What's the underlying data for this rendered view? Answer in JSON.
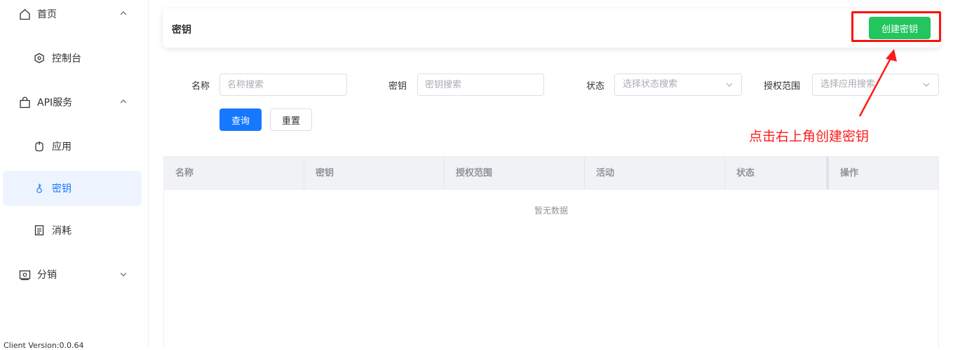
{
  "sidebar": {
    "groups": [
      {
        "label": "首页"
      },
      {
        "label": "API服务"
      },
      {
        "label": "分销"
      }
    ],
    "items": [
      {
        "label": "控制台"
      },
      {
        "label": "应用"
      },
      {
        "label": "密钥"
      },
      {
        "label": "消耗"
      }
    ],
    "version": "Client Version:0.0.64",
    "accent_color": "#eef4ff"
  },
  "header": {
    "title": "密钥",
    "create_button": "创建密钥",
    "create_button_color": "#22c55e"
  },
  "filters": {
    "name_label": "名称",
    "name_placeholder": "名称搜索",
    "key_label": "密钥",
    "key_placeholder": "密钥搜索",
    "status_label": "状态",
    "status_placeholder": "选择状态搜索",
    "scope_label": "授权范围",
    "scope_placeholder": "选择应用搜索",
    "query_button": "查询",
    "reset_button": "重置",
    "primary_color": "#1677ff"
  },
  "annotation": {
    "text": "点击右上角创建密钥",
    "color": "#ff1a1a"
  },
  "table": {
    "columns": [
      "名称",
      "密钥",
      "授权范围",
      "活动",
      "状态",
      "操作"
    ],
    "empty_text": "暂无数据"
  }
}
